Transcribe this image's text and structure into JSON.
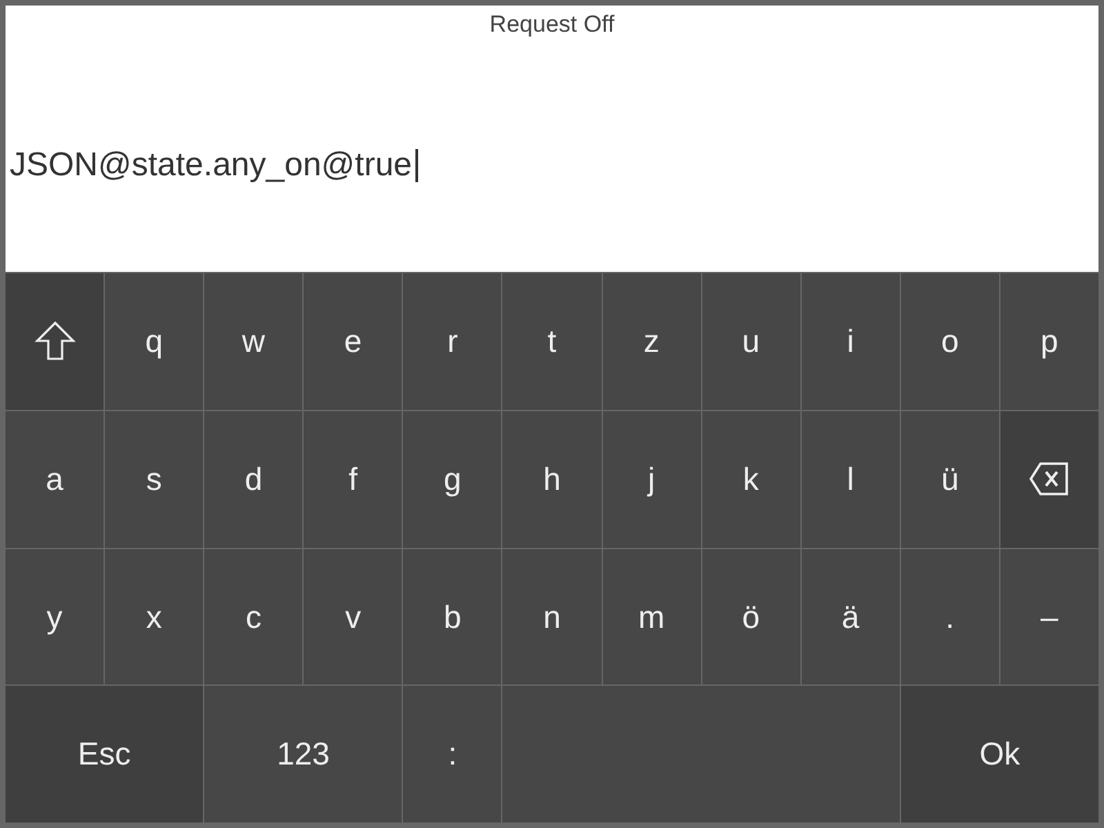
{
  "title": "Request Off",
  "input": {
    "value": "JSON@state.any_on@true",
    "cursor": true
  },
  "keyboard": [
    [
      {
        "kind": "shift"
      },
      {
        "kind": "char",
        "label": "q"
      },
      {
        "kind": "char",
        "label": "w"
      },
      {
        "kind": "char",
        "label": "e"
      },
      {
        "kind": "char",
        "label": "r"
      },
      {
        "kind": "char",
        "label": "t"
      },
      {
        "kind": "char",
        "label": "z"
      },
      {
        "kind": "char",
        "label": "u"
      },
      {
        "kind": "char",
        "label": "i"
      },
      {
        "kind": "char",
        "label": "o"
      },
      {
        "kind": "char",
        "label": "p"
      }
    ],
    [
      {
        "kind": "char",
        "label": "a"
      },
      {
        "kind": "char",
        "label": "s"
      },
      {
        "kind": "char",
        "label": "d"
      },
      {
        "kind": "char",
        "label": "f"
      },
      {
        "kind": "char",
        "label": "g"
      },
      {
        "kind": "char",
        "label": "h"
      },
      {
        "kind": "char",
        "label": "j"
      },
      {
        "kind": "char",
        "label": "k"
      },
      {
        "kind": "char",
        "label": "l"
      },
      {
        "kind": "char",
        "label": "ü"
      },
      {
        "kind": "backspace"
      }
    ],
    [
      {
        "kind": "char",
        "label": "y"
      },
      {
        "kind": "char",
        "label": "x"
      },
      {
        "kind": "char",
        "label": "c"
      },
      {
        "kind": "char",
        "label": "v"
      },
      {
        "kind": "char",
        "label": "b"
      },
      {
        "kind": "char",
        "label": "n"
      },
      {
        "kind": "char",
        "label": "m"
      },
      {
        "kind": "char",
        "label": "ö"
      },
      {
        "kind": "char",
        "label": "ä"
      },
      {
        "kind": "char",
        "label": "."
      },
      {
        "kind": "char",
        "label": "–"
      }
    ],
    [
      {
        "kind": "action",
        "label": "Esc"
      },
      {
        "kind": "wide",
        "label": "123"
      },
      {
        "kind": "char",
        "label": ":"
      },
      {
        "kind": "space"
      },
      {
        "kind": "action",
        "label": "Ok"
      }
    ]
  ]
}
